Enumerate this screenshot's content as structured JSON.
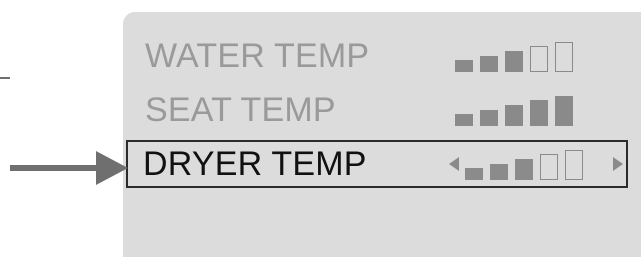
{
  "menu": {
    "items": [
      {
        "label": "WATER TEMP",
        "level": 3,
        "max_level": 5,
        "selected": false
      },
      {
        "label": "SEAT TEMP",
        "level": 5,
        "max_level": 5,
        "selected": false
      },
      {
        "label": "DRYER TEMP",
        "level": 3,
        "max_level": 5,
        "selected": true
      }
    ]
  },
  "colors": {
    "panel": "#dcdcdc",
    "inactive_text": "#9a9a9a",
    "active_text": "#111111",
    "bar": "#8a8a8a",
    "selection_border": "#2b2b2b",
    "pointer": "#6f6f6f"
  },
  "icons": {
    "left_adjust": "left-triangle-icon",
    "right_adjust": "right-triangle-icon",
    "pointer": "arrow-right-icon"
  }
}
